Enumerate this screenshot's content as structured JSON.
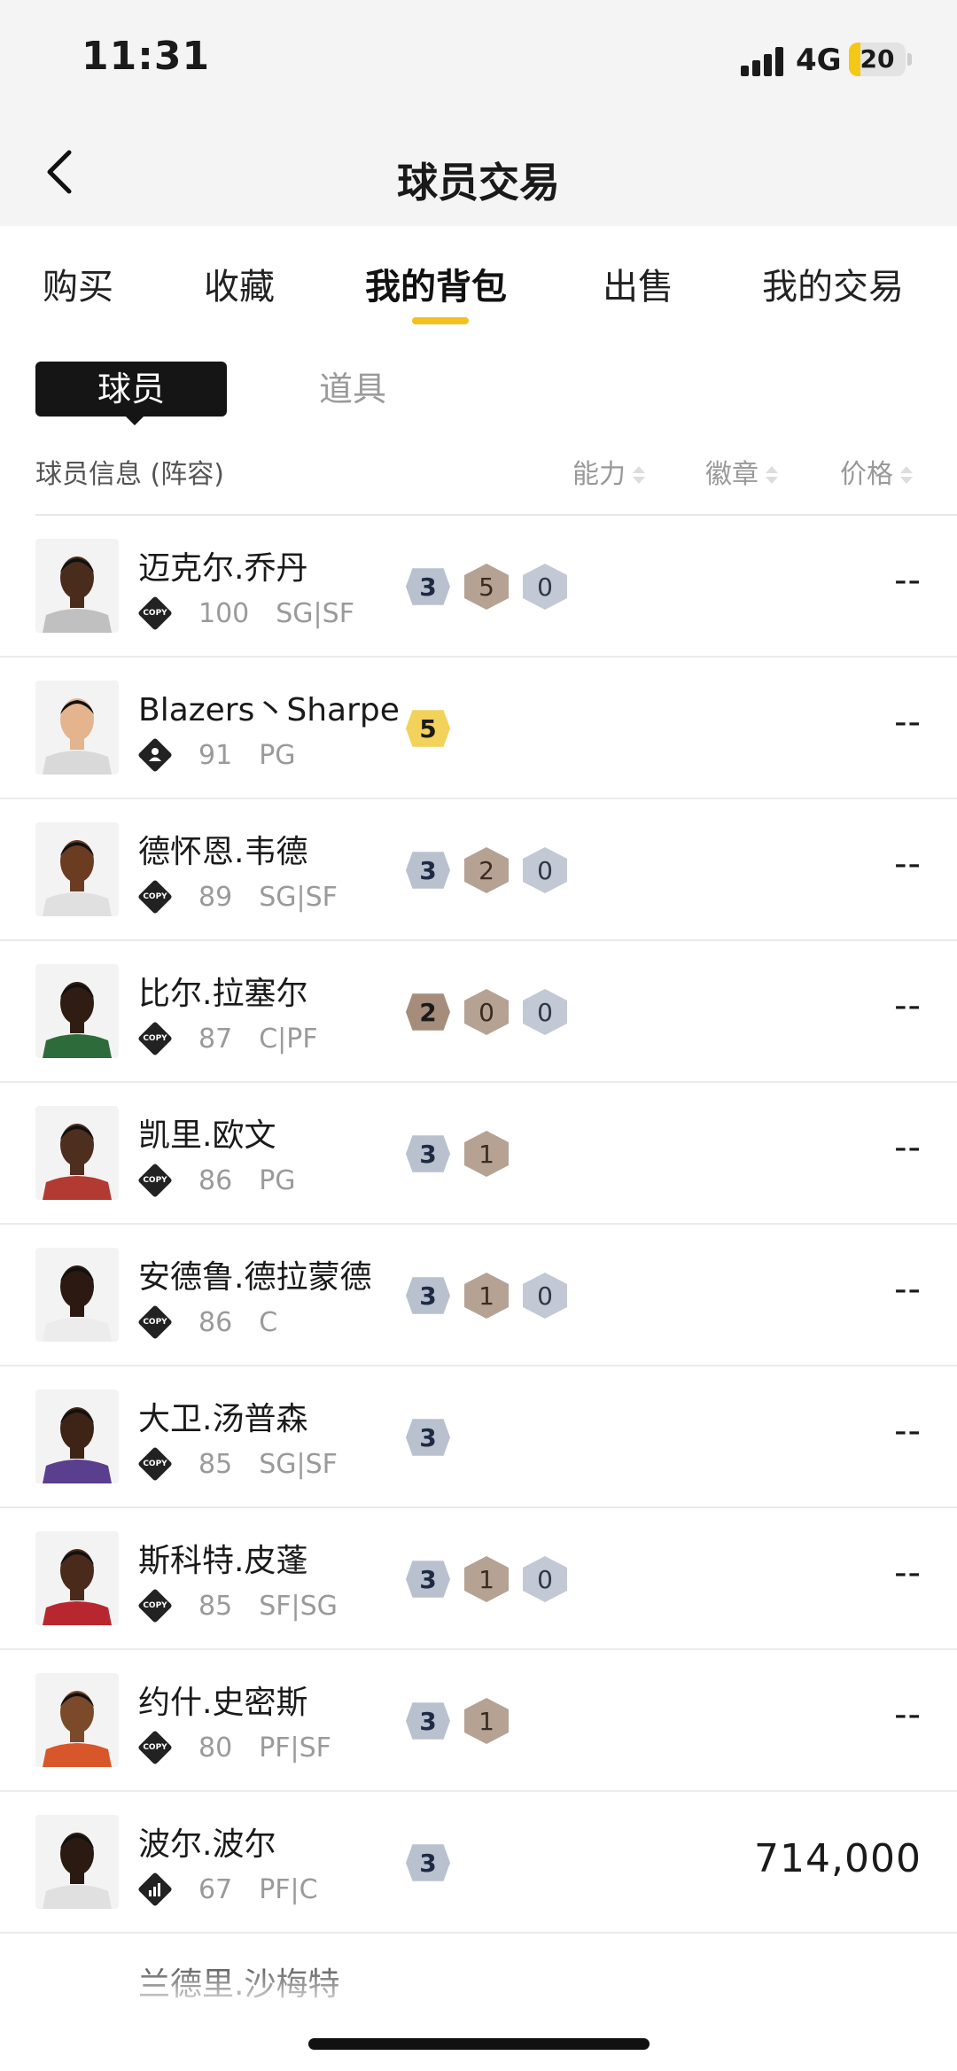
{
  "status_bar": {
    "time": "11:31",
    "network": "4G",
    "battery": "20",
    "battery_fraction": 0.2
  },
  "nav": {
    "title": "球员交易"
  },
  "tabs": [
    {
      "label": "购买",
      "active": false
    },
    {
      "label": "收藏",
      "active": false
    },
    {
      "label": "我的背包",
      "active": true
    },
    {
      "label": "出售",
      "active": false
    },
    {
      "label": "我的交易",
      "active": false
    }
  ],
  "subtabs": {
    "active": "球员",
    "inactive": "道具"
  },
  "columns": {
    "info": "球员信息 (阵容)",
    "ability": "能力",
    "badge": "徽章",
    "price": "价格"
  },
  "players": [
    {
      "name": "迈克尔.乔丹",
      "type": "COPY",
      "score": "100",
      "pos": "SG|SF",
      "level": "3",
      "level_color": "silver",
      "badges": [
        {
          "v": "5",
          "c": "bronze"
        },
        {
          "v": "0",
          "c": "silver"
        }
      ],
      "price": "--",
      "skin": "#4a2c1d",
      "jersey": "#c0c0c0"
    },
    {
      "name": "Blazers丶Sharpe",
      "type": "USER",
      "score": "91",
      "pos": "PG",
      "level": "5",
      "level_color": "gold",
      "badges": [],
      "price": "--",
      "skin": "#e3b48e",
      "jersey": "#d9d9d9"
    },
    {
      "name": "德怀恩.韦德",
      "type": "COPY",
      "score": "89",
      "pos": "SG|SF",
      "level": "3",
      "level_color": "silver",
      "badges": [
        {
          "v": "2",
          "c": "bronze"
        },
        {
          "v": "0",
          "c": "silver"
        }
      ],
      "price": "--",
      "skin": "#6b3b22",
      "jersey": "#e0e0e0"
    },
    {
      "name": "比尔.拉塞尔",
      "type": "COPY",
      "score": "87",
      "pos": "C|PF",
      "level": "2",
      "level_color": "bronze",
      "badges": [
        {
          "v": "0",
          "c": "bronze"
        },
        {
          "v": "0",
          "c": "silver"
        }
      ],
      "price": "--",
      "skin": "#2f1d14",
      "jersey": "#2e6b3a"
    },
    {
      "name": "凯里.欧文",
      "type": "COPY",
      "score": "86",
      "pos": "PG",
      "level": "3",
      "level_color": "silver",
      "badges": [
        {
          "v": "1",
          "c": "bronze"
        }
      ],
      "price": "--",
      "skin": "#4d2e1f",
      "jersey": "#b33a32"
    },
    {
      "name": "安德鲁.德拉蒙德",
      "type": "COPY",
      "score": "86",
      "pos": "C",
      "level": "3",
      "level_color": "silver",
      "badges": [
        {
          "v": "1",
          "c": "bronze"
        },
        {
          "v": "0",
          "c": "silver"
        }
      ],
      "price": "--",
      "skin": "#2c1a12",
      "jersey": "#ececec"
    },
    {
      "name": "大卫.汤普森",
      "type": "COPY",
      "score": "85",
      "pos": "SG|SF",
      "level": "3",
      "level_color": "silver",
      "badges": [],
      "price": "--",
      "skin": "#3d2416",
      "jersey": "#5a3f8f"
    },
    {
      "name": "斯科特.皮蓬",
      "type": "COPY",
      "score": "85",
      "pos": "SF|SG",
      "level": "3",
      "level_color": "silver",
      "badges": [
        {
          "v": "1",
          "c": "bronze"
        },
        {
          "v": "0",
          "c": "silver"
        }
      ],
      "price": "--",
      "skin": "#4a2a1a",
      "jersey": "#b8272f"
    },
    {
      "name": "约什.史密斯",
      "type": "COPY",
      "score": "80",
      "pos": "PF|SF",
      "level": "3",
      "level_color": "silver",
      "badges": [
        {
          "v": "1",
          "c": "bronze"
        }
      ],
      "price": "--",
      "skin": "#7a4a2a",
      "jersey": "#d7572b"
    },
    {
      "name": "波尔.波尔",
      "type": "STATS",
      "score": "67",
      "pos": "PF|C",
      "level": "3",
      "level_color": "silver",
      "badges": [],
      "price": "714,000",
      "skin": "#2a1a12",
      "jersey": "#e0e0e0"
    }
  ],
  "partial_row": {
    "name": "兰德里.沙梅特"
  }
}
